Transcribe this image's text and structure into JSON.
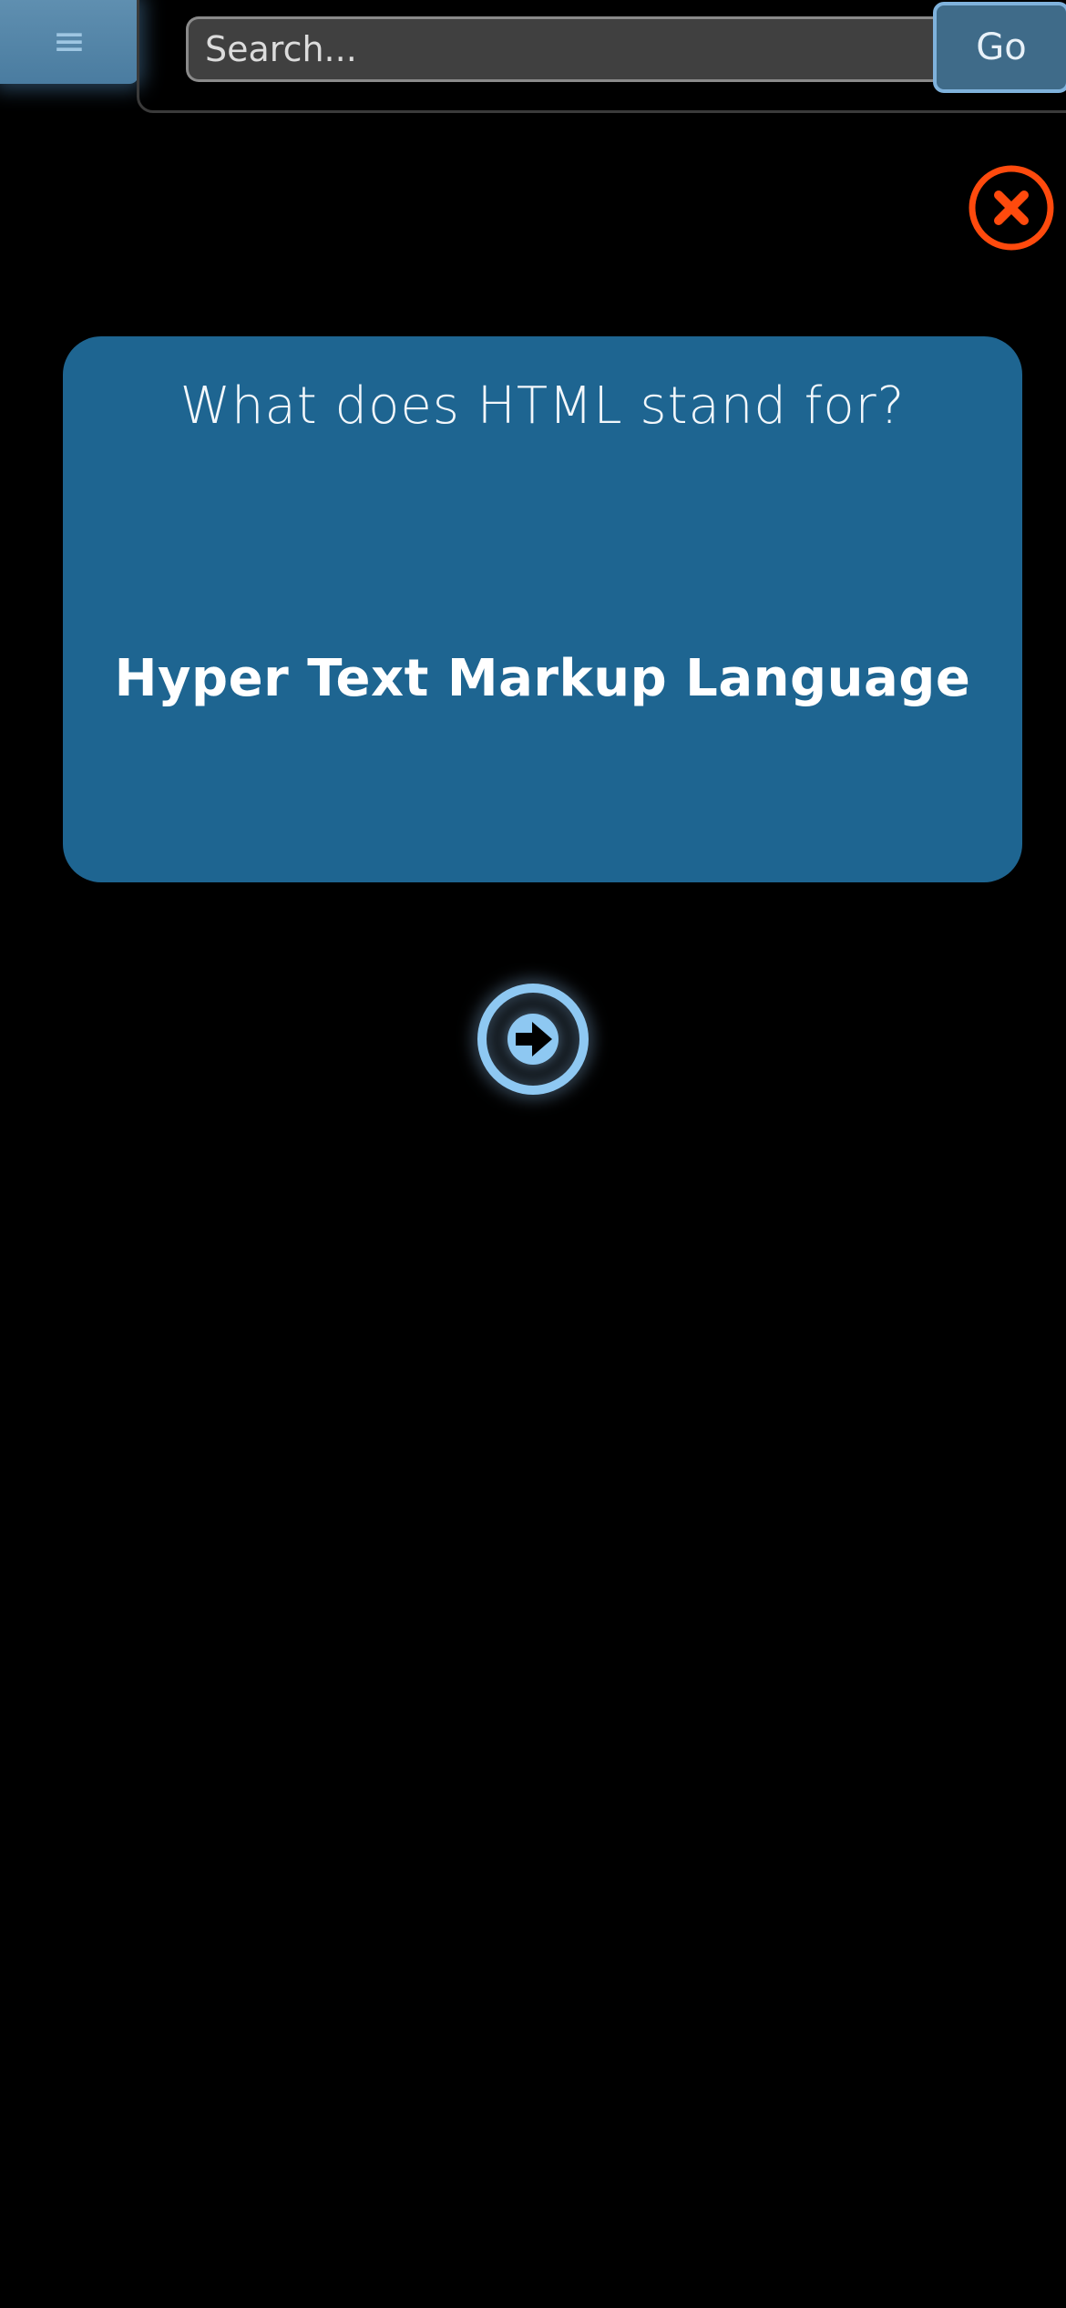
{
  "header": {
    "menu_glyph": "≡",
    "menu_icon": "hamburger-icon",
    "search_placeholder": "Search...",
    "go_label": "Go"
  },
  "colors": {
    "background": "#000000",
    "card": "#1e6591",
    "close_accent": "#ff4a0d",
    "next_accent": "#8ec8f2",
    "menu_button": "#4a7ca0"
  },
  "controls": {
    "close_icon": "close-circle-icon",
    "next_icon": "arrow-right-circle-icon"
  },
  "card": {
    "question": "What does HTML stand for?",
    "answer": "Hyper Text Markup Language"
  }
}
